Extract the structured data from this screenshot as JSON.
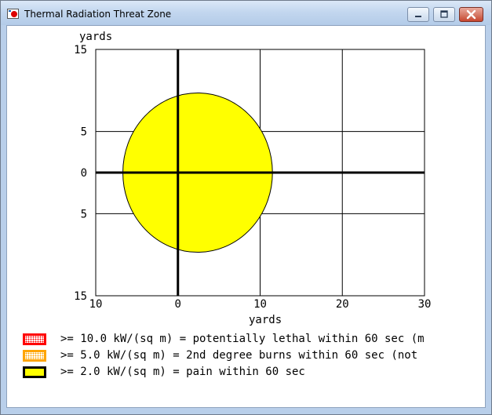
{
  "window": {
    "title": "Thermal Radiation Threat Zone",
    "buttons": {
      "minimize_icon": "minimize-icon",
      "maximize_icon": "maximize-icon",
      "close_icon": "close-icon"
    }
  },
  "chart_data": {
    "type": "area",
    "title": "",
    "xlabel": "yards",
    "ylabel": "yards",
    "xlim": [
      -10,
      30
    ],
    "ylim": [
      -15,
      15
    ],
    "x_ticks": [
      -10,
      0,
      10,
      20,
      30
    ],
    "y_ticks": [
      15,
      5,
      0,
      -5,
      -15
    ],
    "x_tick_labels": [
      "10",
      "0",
      "10",
      "20",
      "30"
    ],
    "y_tick_labels": [
      "15",
      "5",
      "0",
      "5",
      "15"
    ],
    "grid": true,
    "legend_placement": "bottom",
    "series": [
      {
        "name": ">= 2.0 kW/(sq m) = pain within 60 sec",
        "color": "#ffff00",
        "shape": "ellipse",
        "center": [
          2.4,
          0
        ],
        "x_extent": [
          -6.6,
          11.6
        ],
        "y_extent": [
          -9.7,
          9.7
        ]
      }
    ]
  },
  "legend": [
    {
      "label": ">= 10.0 kW/(sq m) = potentially lethal within 60 sec (m",
      "border_color": "#ff0000",
      "fill_color": "#ffffff",
      "fill_pattern": "red-dots"
    },
    {
      "label": ">= 5.0 kW/(sq m) = 2nd degree burns within 60 sec (not",
      "border_color": "#ffa500",
      "fill_color": "#ffffff",
      "fill_pattern": "orange-dots"
    },
    {
      "label": ">= 2.0 kW/(sq m) = pain within 60 sec",
      "border_color": "#000000",
      "fill_color": "#ffff00",
      "fill_pattern": "solid"
    }
  ]
}
